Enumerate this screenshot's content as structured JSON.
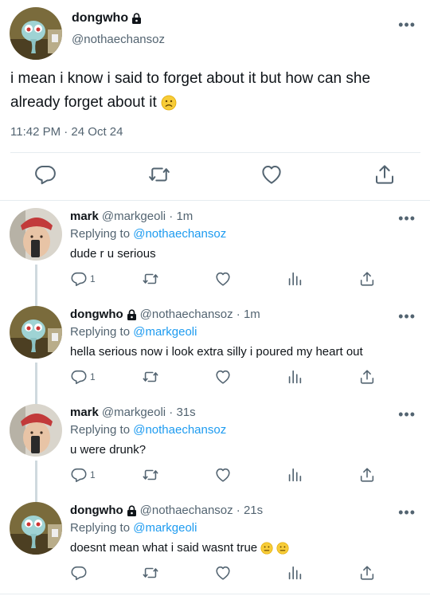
{
  "main_tweet": {
    "name": "dongwho",
    "handle": "@nothaechansoz",
    "text": "i mean i know i said to forget about it but how can she already forget about it",
    "timestamp": "11:42 PM · 24 Oct 24",
    "emoji": "slightly-frowning-face"
  },
  "replies": [
    {
      "name": "mark",
      "handle": "@markgeoli · 1m",
      "replying_label": "Replying to",
      "replying_to": "@nothaechansoz",
      "text": "dude r u serious",
      "reply_count": "1",
      "avatar": "mark"
    },
    {
      "name": "dongwho",
      "handle": "@nothaechansoz · 1m",
      "replying_label": "Replying to",
      "replying_to": "@markgeoli",
      "text": "hella serious now i look extra silly i poured my heart out",
      "reply_count": "1",
      "avatar": "dongwho"
    },
    {
      "name": "mark",
      "handle": "@markgeoli · 31s",
      "replying_label": "Replying to",
      "replying_to": "@nothaechansoz",
      "text": "u were drunk?",
      "reply_count": "1",
      "avatar": "mark"
    },
    {
      "name": "dongwho",
      "handle": "@nothaechansoz · 21s",
      "replying_label": "Replying to",
      "replying_to": "@markgeoli",
      "text": "doesnt mean what i said wasnt true",
      "reply_count": "",
      "avatar": "dongwho"
    }
  ],
  "more_label": "•••",
  "colors": {
    "link": "#1d9bf0",
    "secondary": "#536471",
    "divider": "#e6ecf0"
  }
}
